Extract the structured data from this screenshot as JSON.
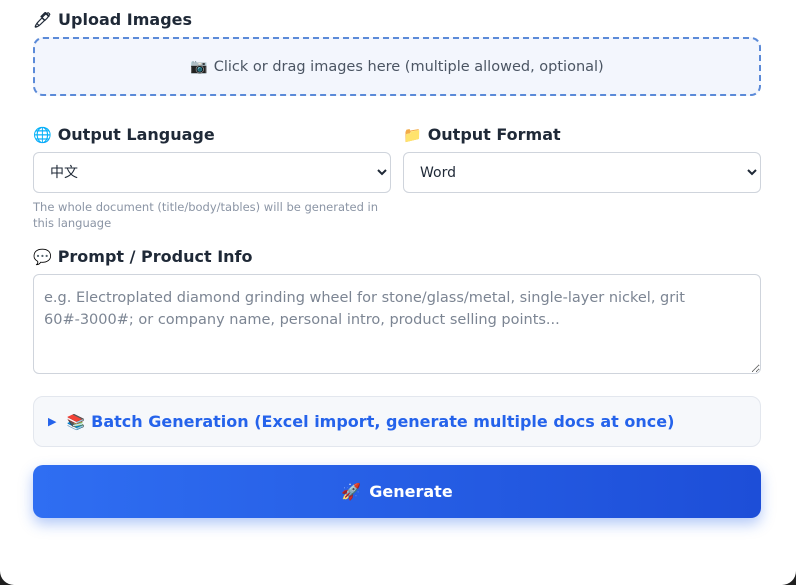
{
  "upload": {
    "icon": "pen-icon",
    "label": "Upload Images",
    "zone_icon": "camera-icon",
    "zone_text": "Click or drag images here (multiple allowed, optional)"
  },
  "language": {
    "icon": "globe-icon",
    "label": "Output Language",
    "selected": "中文",
    "hint": "The whole document (title/body/tables) will be generated in this language"
  },
  "format": {
    "icon": "folder-icon",
    "label": "Output Format",
    "selected": "Word"
  },
  "prompt": {
    "icon": "speech-bubble-icon",
    "label": "Prompt / Product Info",
    "placeholder": "e.g. Electroplated diamond grinding wheel for stone/glass/metal, single-layer nickel, grit 60#-3000#; or company name, personal intro, product selling points..."
  },
  "batch": {
    "icon": "books-icon",
    "label": "Batch Generation (Excel import, generate multiple docs at once)"
  },
  "generate": {
    "icon": "rocket-icon",
    "label": "Generate"
  },
  "colors": {
    "accent": "#2563eb",
    "upload_border": "#5b8ad8",
    "upload_bg": "#f3f6fd"
  }
}
